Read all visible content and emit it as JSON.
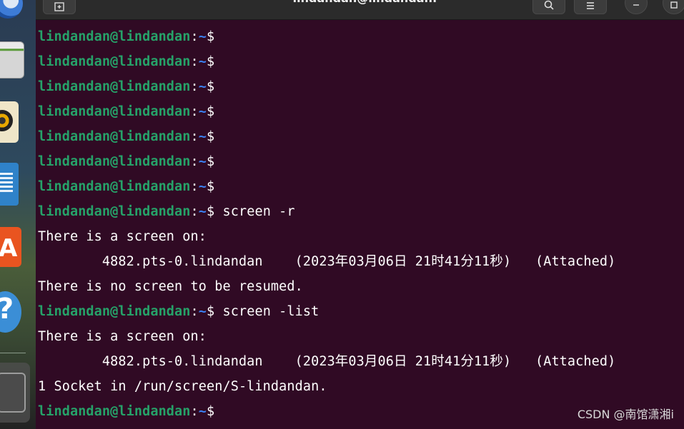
{
  "window": {
    "title": "lindandan@lindandan: ~",
    "buttons": {
      "new_tab_icon": "new-tab-icon",
      "search_icon": "search-icon",
      "menu_icon": "hamburger-menu-icon",
      "minimize_icon": "minimize-icon",
      "maximize_icon": "maximize-icon"
    }
  },
  "dock": {
    "items": [
      {
        "name": "thunderbird-icon"
      },
      {
        "name": "files-icon"
      },
      {
        "name": "rhythmbox-icon"
      },
      {
        "name": "libreoffice-writer-icon"
      },
      {
        "name": "app-center-icon",
        "glyph": "A"
      },
      {
        "name": "help-icon",
        "glyph": "?"
      },
      {
        "name": "show-apps-icon"
      }
    ]
  },
  "prompt": {
    "user": "lindandan@lindandan",
    "colon": ":",
    "path": "~",
    "symbol": "$"
  },
  "terminal": {
    "lines": [
      {
        "type": "prompt",
        "cmd": ""
      },
      {
        "type": "prompt",
        "cmd": ""
      },
      {
        "type": "prompt",
        "cmd": ""
      },
      {
        "type": "prompt",
        "cmd": ""
      },
      {
        "type": "prompt",
        "cmd": ""
      },
      {
        "type": "prompt",
        "cmd": ""
      },
      {
        "type": "prompt",
        "cmd": ""
      },
      {
        "type": "prompt",
        "cmd": " screen -r"
      },
      {
        "type": "output",
        "text": "There is a screen on:"
      },
      {
        "type": "output",
        "text": "        4882.pts-0.lindandan    (2023年03月06日 21时41分11秒)   (Attached)"
      },
      {
        "type": "output",
        "text": "There is no screen to be resumed."
      },
      {
        "type": "prompt",
        "cmd": " screen -list"
      },
      {
        "type": "output",
        "text": "There is a screen on:"
      },
      {
        "type": "output",
        "text": "        4882.pts-0.lindandan    (2023年03月06日 21时41分11秒)   (Attached)"
      },
      {
        "type": "output",
        "text": "1 Socket in /run/screen/S-lindandan."
      },
      {
        "type": "prompt",
        "cmd": ""
      }
    ]
  },
  "watermark": "CSDN @南馆潇湘i",
  "colors": {
    "background": "#300a24",
    "user": "#26a269",
    "path": "#3b82f6",
    "text": "#ffffff"
  }
}
